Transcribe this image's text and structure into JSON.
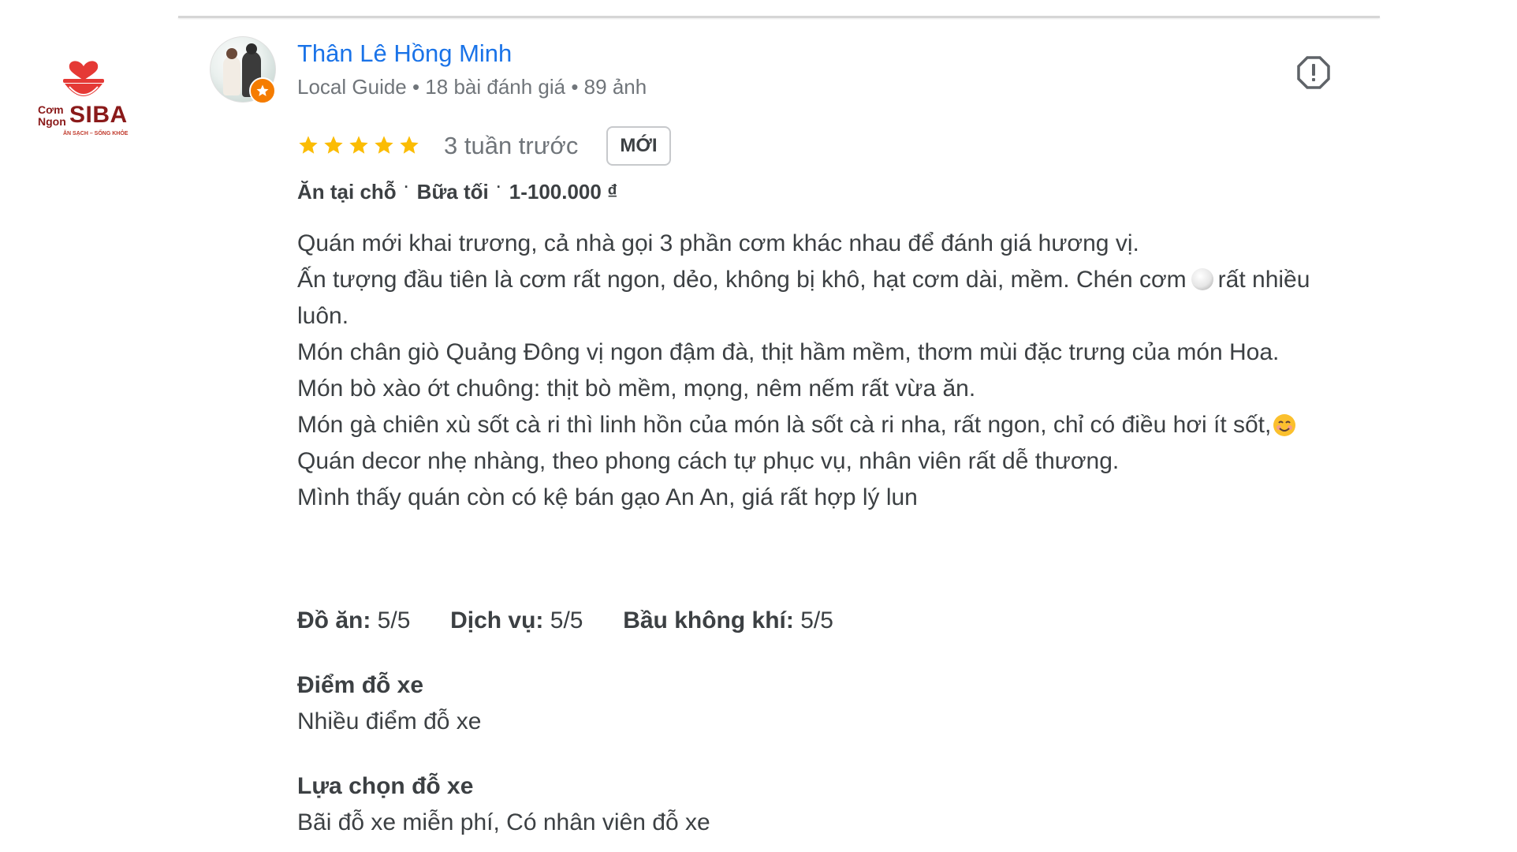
{
  "brand": {
    "logo_line1": "Cơm",
    "logo_line2": "Ngon",
    "logo_main": "SIBA",
    "logo_tagline": "ĂN SẠCH – SỐNG KHỎE",
    "color": "#8a1a1a"
  },
  "review": {
    "reviewer_name": "Thân Lê Hồng Minh",
    "reviewer_meta": "Local Guide • 18 bài đánh giá • 89 ảnh",
    "rating_stars": 5,
    "time_ago": "3 tuần trước",
    "new_badge": "MỚI",
    "attributes": [
      "Ăn tại chỗ",
      "Bữa tối",
      "1-100.000 ₫"
    ],
    "lines": [
      "Quán mới khai trương, cả nhà gọi 3 phần cơm khác nhau để đánh giá hương vị.",
      "Ấn tượng đầu tiên là cơm rất ngon, dẻo, không bị khô, hạt cơm dài, mềm. Chén cơm",
      "rất nhiều luôn.",
      "Món chân giò Quảng Đông vị ngon đậm đà, thịt hầm mềm, thơm mùi đặc trưng của món Hoa.",
      "Món bò xào ớt chuông: thịt bò mềm, mọng, nêm nếm rất vừa ăn.",
      "Món gà chiên xù sốt cà ri thì linh hồn của món là sốt cà ri nha, rất ngon, chỉ có điều hơi ít sốt,",
      "Quán decor nhẹ nhàng, theo phong cách tự phục vụ, nhân viên rất dễ thương.",
      "Mình thấy quán còn có kệ bán gạo An An, giá rất hợp lý lun"
    ],
    "ratings": [
      {
        "label": "Đồ ăn:",
        "value": "5/5"
      },
      {
        "label": "Dịch vụ:",
        "value": "5/5"
      },
      {
        "label": "Bầu không khí:",
        "value": "5/5"
      }
    ],
    "parking_title": "Điểm đỗ xe",
    "parking_value": "Nhiều điểm đỗ xe",
    "parking_options_title": "Lựa chọn đỗ xe",
    "parking_options_value": "Bãi đỗ xe miễn phí, Có nhân viên đỗ xe"
  },
  "colors": {
    "link": "#1a73e8",
    "star": "#fbbc04",
    "meta": "#70757a",
    "text": "#3c4043"
  },
  "icons": {
    "report": "report-flag-icon",
    "guide": "local-guide-star-icon",
    "star": "star-icon"
  }
}
